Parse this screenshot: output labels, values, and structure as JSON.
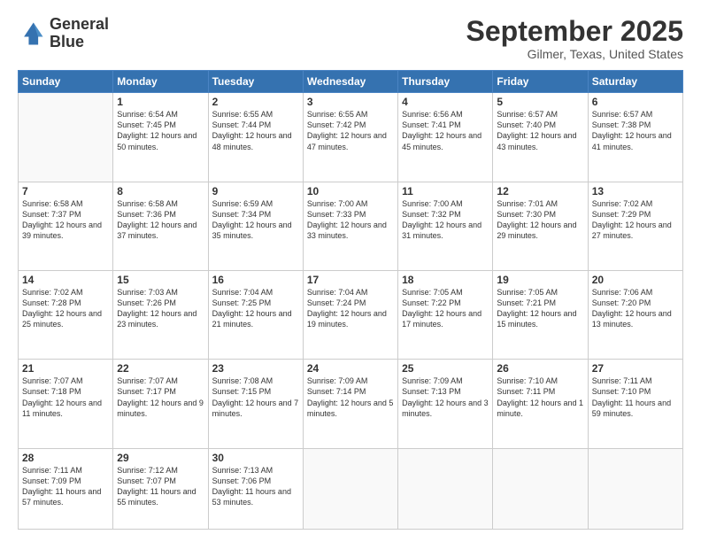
{
  "header": {
    "logo_line1": "General",
    "logo_line2": "Blue",
    "month": "September 2025",
    "location": "Gilmer, Texas, United States"
  },
  "days_of_week": [
    "Sunday",
    "Monday",
    "Tuesday",
    "Wednesday",
    "Thursday",
    "Friday",
    "Saturday"
  ],
  "weeks": [
    [
      {
        "day": "",
        "info": ""
      },
      {
        "day": "1",
        "info": "Sunrise: 6:54 AM\nSunset: 7:45 PM\nDaylight: 12 hours\nand 50 minutes."
      },
      {
        "day": "2",
        "info": "Sunrise: 6:55 AM\nSunset: 7:44 PM\nDaylight: 12 hours\nand 48 minutes."
      },
      {
        "day": "3",
        "info": "Sunrise: 6:55 AM\nSunset: 7:42 PM\nDaylight: 12 hours\nand 47 minutes."
      },
      {
        "day": "4",
        "info": "Sunrise: 6:56 AM\nSunset: 7:41 PM\nDaylight: 12 hours\nand 45 minutes."
      },
      {
        "day": "5",
        "info": "Sunrise: 6:57 AM\nSunset: 7:40 PM\nDaylight: 12 hours\nand 43 minutes."
      },
      {
        "day": "6",
        "info": "Sunrise: 6:57 AM\nSunset: 7:38 PM\nDaylight: 12 hours\nand 41 minutes."
      }
    ],
    [
      {
        "day": "7",
        "info": "Sunrise: 6:58 AM\nSunset: 7:37 PM\nDaylight: 12 hours\nand 39 minutes."
      },
      {
        "day": "8",
        "info": "Sunrise: 6:58 AM\nSunset: 7:36 PM\nDaylight: 12 hours\nand 37 minutes."
      },
      {
        "day": "9",
        "info": "Sunrise: 6:59 AM\nSunset: 7:34 PM\nDaylight: 12 hours\nand 35 minutes."
      },
      {
        "day": "10",
        "info": "Sunrise: 7:00 AM\nSunset: 7:33 PM\nDaylight: 12 hours\nand 33 minutes."
      },
      {
        "day": "11",
        "info": "Sunrise: 7:00 AM\nSunset: 7:32 PM\nDaylight: 12 hours\nand 31 minutes."
      },
      {
        "day": "12",
        "info": "Sunrise: 7:01 AM\nSunset: 7:30 PM\nDaylight: 12 hours\nand 29 minutes."
      },
      {
        "day": "13",
        "info": "Sunrise: 7:02 AM\nSunset: 7:29 PM\nDaylight: 12 hours\nand 27 minutes."
      }
    ],
    [
      {
        "day": "14",
        "info": "Sunrise: 7:02 AM\nSunset: 7:28 PM\nDaylight: 12 hours\nand 25 minutes."
      },
      {
        "day": "15",
        "info": "Sunrise: 7:03 AM\nSunset: 7:26 PM\nDaylight: 12 hours\nand 23 minutes."
      },
      {
        "day": "16",
        "info": "Sunrise: 7:04 AM\nSunset: 7:25 PM\nDaylight: 12 hours\nand 21 minutes."
      },
      {
        "day": "17",
        "info": "Sunrise: 7:04 AM\nSunset: 7:24 PM\nDaylight: 12 hours\nand 19 minutes."
      },
      {
        "day": "18",
        "info": "Sunrise: 7:05 AM\nSunset: 7:22 PM\nDaylight: 12 hours\nand 17 minutes."
      },
      {
        "day": "19",
        "info": "Sunrise: 7:05 AM\nSunset: 7:21 PM\nDaylight: 12 hours\nand 15 minutes."
      },
      {
        "day": "20",
        "info": "Sunrise: 7:06 AM\nSunset: 7:20 PM\nDaylight: 12 hours\nand 13 minutes."
      }
    ],
    [
      {
        "day": "21",
        "info": "Sunrise: 7:07 AM\nSunset: 7:18 PM\nDaylight: 12 hours\nand 11 minutes."
      },
      {
        "day": "22",
        "info": "Sunrise: 7:07 AM\nSunset: 7:17 PM\nDaylight: 12 hours\nand 9 minutes."
      },
      {
        "day": "23",
        "info": "Sunrise: 7:08 AM\nSunset: 7:15 PM\nDaylight: 12 hours\nand 7 minutes."
      },
      {
        "day": "24",
        "info": "Sunrise: 7:09 AM\nSunset: 7:14 PM\nDaylight: 12 hours\nand 5 minutes."
      },
      {
        "day": "25",
        "info": "Sunrise: 7:09 AM\nSunset: 7:13 PM\nDaylight: 12 hours\nand 3 minutes."
      },
      {
        "day": "26",
        "info": "Sunrise: 7:10 AM\nSunset: 7:11 PM\nDaylight: 12 hours\nand 1 minute."
      },
      {
        "day": "27",
        "info": "Sunrise: 7:11 AM\nSunset: 7:10 PM\nDaylight: 11 hours\nand 59 minutes."
      }
    ],
    [
      {
        "day": "28",
        "info": "Sunrise: 7:11 AM\nSunset: 7:09 PM\nDaylight: 11 hours\nand 57 minutes."
      },
      {
        "day": "29",
        "info": "Sunrise: 7:12 AM\nSunset: 7:07 PM\nDaylight: 11 hours\nand 55 minutes."
      },
      {
        "day": "30",
        "info": "Sunrise: 7:13 AM\nSunset: 7:06 PM\nDaylight: 11 hours\nand 53 minutes."
      },
      {
        "day": "",
        "info": ""
      },
      {
        "day": "",
        "info": ""
      },
      {
        "day": "",
        "info": ""
      },
      {
        "day": "",
        "info": ""
      }
    ]
  ]
}
